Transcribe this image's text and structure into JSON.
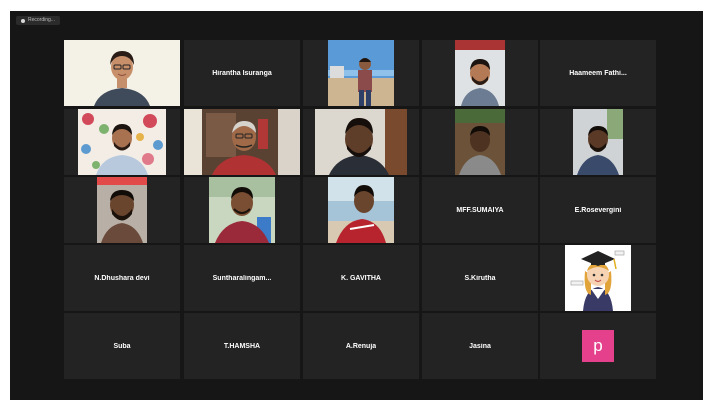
{
  "app": {
    "recording_label": "Recording..."
  },
  "participants": [
    {
      "name": "Hirantha Isuranga"
    },
    {
      "name": "Haameem  Fathi..."
    },
    {
      "name": "MFF.SUMAIYA"
    },
    {
      "name": "E.Rosevergini"
    },
    {
      "name": "N.Dhushara devi"
    },
    {
      "name": "Suntharalingam..."
    },
    {
      "name": "K. GAVITHA"
    },
    {
      "name": "S.Kirutha"
    },
    {
      "name": "Suba"
    },
    {
      "name": "T.HAMSHA"
    },
    {
      "name": "A.Renuja"
    },
    {
      "name": "Jasina"
    }
  ],
  "avatar_letter": "p",
  "colors": {
    "background": "#161616",
    "tile": "#232323",
    "active_border": "#cfe5a4",
    "avatar": "#e5408c"
  }
}
